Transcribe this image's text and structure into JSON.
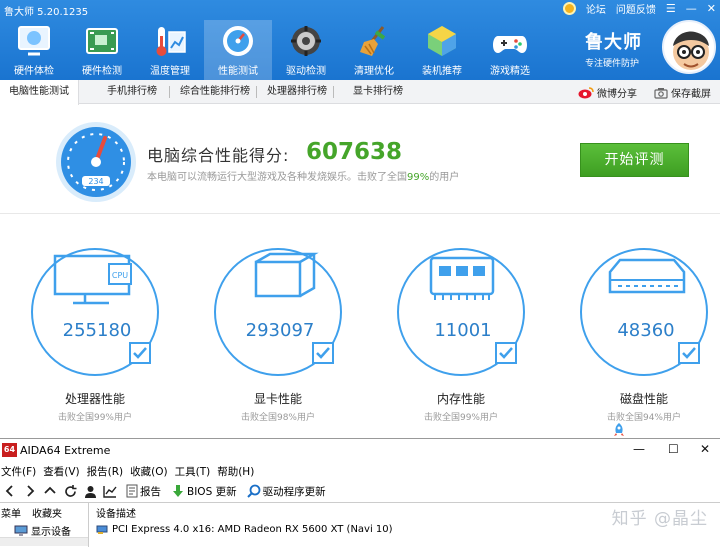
{
  "app": {
    "name": "鲁大师 5.20.1235",
    "title_links": [
      "论坛",
      "问题反馈"
    ],
    "window_controls": [
      "☰",
      "—",
      "✕"
    ],
    "brand_name": "鲁大师",
    "brand_slogan": "专注硬件防护"
  },
  "toolbar": [
    {
      "label": "硬件体检",
      "icon": "hardware-check-icon"
    },
    {
      "label": "硬件检测",
      "icon": "circuit-board-icon"
    },
    {
      "label": "温度管理",
      "icon": "thermometer-icon"
    },
    {
      "label": "性能测试",
      "icon": "speedometer-icon",
      "active": true
    },
    {
      "label": "驱动检测",
      "icon": "driver-gear-icon"
    },
    {
      "label": "清理优化",
      "icon": "broom-icon"
    },
    {
      "label": "装机推荐",
      "icon": "cube-icon"
    },
    {
      "label": "游戏精选",
      "icon": "gamepad-icon"
    }
  ],
  "tabs": [
    {
      "label": "电脑性能测试",
      "active": true
    },
    {
      "label": "手机排行榜"
    },
    {
      "label": "综合性能排行榜"
    },
    {
      "label": "处理器排行榜"
    },
    {
      "label": "显卡排行榜"
    }
  ],
  "share": {
    "weibo": "微博分享",
    "screenshot": "保存截屏"
  },
  "score": {
    "label": "电脑综合性能得分:",
    "value": "607638",
    "gauge_reading": "234",
    "sub_prefix": "本电脑可以流畅运行大型游戏及各种发烧娱乐。击败了全国",
    "sub_highlight": "99%",
    "sub_suffix": "的用户",
    "button": "开始评测"
  },
  "cards": [
    {
      "value": "255180",
      "title": "处理器性能",
      "sub": "击败全国99%用户",
      "icon": "cpu-monitor-icon",
      "chip_label": "CPU"
    },
    {
      "value": "293097",
      "title": "显卡性能",
      "sub": "击败全国98%用户",
      "icon": "graphics-cube-icon"
    },
    {
      "value": "11001",
      "title": "内存性能",
      "sub": "击败全国99%用户",
      "icon": "memory-chip-icon"
    },
    {
      "value": "48360",
      "title": "磁盘性能",
      "sub": "击败全国94%用户",
      "icon": "hard-disk-icon"
    }
  ],
  "aida": {
    "logo": "64",
    "title": "AIDA64 Extreme",
    "controls": [
      "—",
      "☐",
      "✕"
    ],
    "menu": [
      "文件(F)",
      "查看(V)",
      "报告(R)",
      "收藏(O)",
      "工具(T)",
      "帮助(H)"
    ],
    "toolbar": {
      "report": "报告",
      "bios": "BIOS 更新",
      "driver": "驱动程序更新"
    },
    "pane_tabs": [
      "菜单",
      "收藏夹"
    ],
    "tree_item": "显示设备",
    "column_header": "设备描述",
    "device_row": "PCI Express 4.0 x16: AMD Radeon RX 5600 XT (Navi 10)"
  },
  "watermark": "知乎 @晶尘",
  "colors": {
    "accent_blue": "#1a74d0",
    "score_green": "#45a52a",
    "circle_blue": "#3fa0ec",
    "aida_red": "#c81e1e"
  }
}
